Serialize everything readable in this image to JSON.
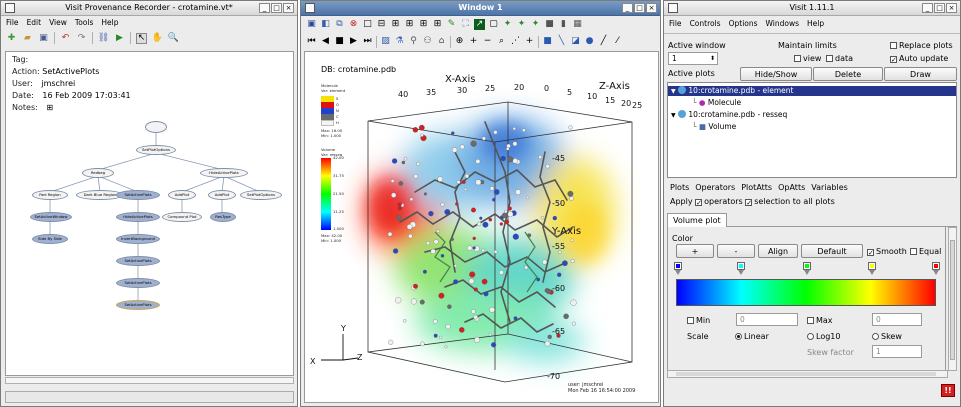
{
  "provenance": {
    "title": "Visit Provenance Recorder - crotamine.vt*",
    "menu": [
      "File",
      "Edit",
      "View",
      "Tools",
      "Help"
    ],
    "info": {
      "tag_label": "Tag:",
      "action_label": "Action:",
      "action_value": "SetActivePlots",
      "user_label": "User:",
      "user_value": "jmschrei",
      "date_label": "Date:",
      "date_value": "16 Feb 2009 17:03:41",
      "notes_label": "Notes:",
      "notes_icon": "⊞"
    },
    "graph": {
      "root": "",
      "n1": "SetPlotOptions",
      "n2": "Redbeg",
      "n3": "HideActivePlots",
      "n4": "Red Region",
      "n5": "Dark Blue Region",
      "n6": "SetActivePlots",
      "n7": "AddPlot",
      "n8": "AddPlot",
      "n9": "SetPlotOptions",
      "n10": "SetActiveWindow",
      "n11": "HideActivePlots",
      "n12": "Compound Plot",
      "n13": "ResType",
      "n14": "Side By Side",
      "n15": "InvertBackground",
      "n16": "SetActivePlots",
      "n17": "SetActivePlots",
      "n18": "SetActivePlots"
    }
  },
  "viewer": {
    "title": "Window 1",
    "db_label": "DB: crotamine.pdb",
    "legend_molecule": {
      "title": "Molecule",
      "var": "Var: element",
      "entries": [
        "S",
        "O",
        "N",
        "C",
        "H"
      ],
      "colors": [
        "#f2e400",
        "#e01010",
        "#2040d0",
        "#6a6a6a",
        "#f4f4f4"
      ],
      "max": "Max: 16.00",
      "min": "Min: 1.000"
    },
    "legend_volume": {
      "title": "Volume",
      "var": "Var: resseq",
      "ticks": [
        "42.00",
        "31.75",
        "21.50",
        "11.25",
        "1.000"
      ],
      "max": "Max: 42.00",
      "min": "Min: 1.000"
    },
    "axes": {
      "x_title": "X-Axis",
      "z_title": "Z-Axis",
      "y_title": "Y-Axis",
      "x_ticks": [
        "40",
        "35",
        "30",
        "25",
        "20"
      ],
      "z_ticks": [
        "0",
        "5",
        "10",
        "15",
        "20",
        "25"
      ],
      "y_ticks": [
        "-45",
        "-50",
        "-55",
        "-60",
        "-65",
        "-70"
      ],
      "triad_x": "X",
      "triad_y": "Y",
      "triad_z": "Z"
    },
    "footer_user": "user: jmschrei",
    "footer_date": "Mon Feb 16 16:54:00 2009"
  },
  "gui": {
    "title": "Visit 1.11.1",
    "menu": [
      "File",
      "Controls",
      "Options",
      "Windows",
      "Help"
    ],
    "active_window_label": "Active window",
    "active_window_value": "1",
    "maintain_limits_label": "Maintain limits",
    "view_label": "view",
    "data_label": "data",
    "replace_plots_label": "Replace plots",
    "auto_update_label": "Auto update",
    "active_plots_label": "Active plots",
    "hide_show_label": "Hide/Show",
    "delete_label": "Delete",
    "draw_label": "Draw",
    "plots": [
      {
        "name": "10:crotamine.pdb - element",
        "child": "Molecule"
      },
      {
        "name": "10:crotamine.pdb - resseq",
        "child": "Volume"
      }
    ],
    "tabs_menu": [
      "Plots",
      "Operators",
      "PlotAtts",
      "OpAtts",
      "Variables"
    ],
    "apply_label": "Apply",
    "operators_label": "operators",
    "selection_label": "selection to all plots",
    "volume_tab": "Volume plot",
    "color_label": "Color",
    "plus_label": "+",
    "minus_label": "-",
    "align_label": "Align",
    "default_label": "Default",
    "smooth_label": "Smooth",
    "equal_label": "Equal",
    "min_label": "Min",
    "min_value": "0",
    "max_label": "Max",
    "max_value": "0",
    "scale_label": "Scale",
    "linear_label": "Linear",
    "log10_label": "Log10",
    "skew_label": "Skew",
    "skew_factor_label": "Skew factor",
    "skew_factor_value": "1",
    "warn_icon": "!!"
  }
}
